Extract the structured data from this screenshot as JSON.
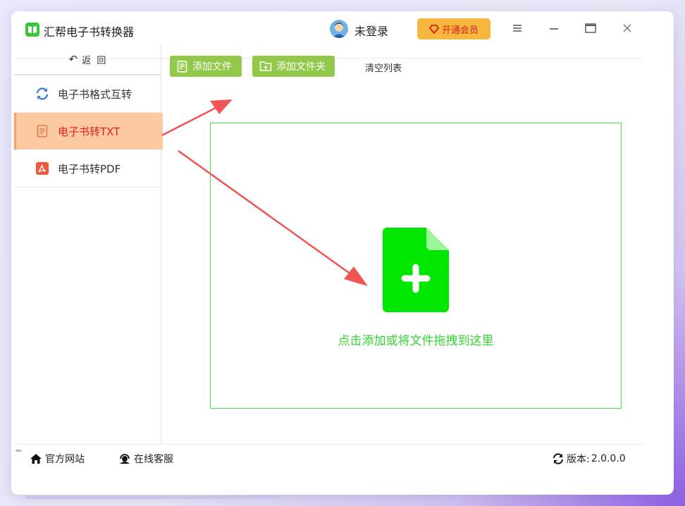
{
  "window": {
    "title": "汇帮电子书转换器",
    "login_label": "未登录",
    "vip_label": "开通会员"
  },
  "sidebar": {
    "back_label": "返  回",
    "items": [
      {
        "label": "电子书格式互转",
        "icon": "refresh-icon",
        "active": false
      },
      {
        "label": "电子书转TXT",
        "icon": "document-icon",
        "active": true
      },
      {
        "label": "电子书转PDF",
        "icon": "pdf-icon",
        "active": false
      }
    ]
  },
  "toolbar": {
    "add_file_label": "添加文件",
    "add_folder_label": "添加文件夹",
    "clear_label": "清空列表"
  },
  "dropzone": {
    "hint": "点击添加或将文件拖拽到这里"
  },
  "footer": {
    "website_label": "官方网站",
    "support_label": "在线客服",
    "version_label": "版本:",
    "version_value": "2.0.0.0"
  },
  "colors": {
    "accent_green": "#93c94a",
    "drop_green": "#00e600",
    "active_bg": "#fdc9a0",
    "active_text": "#e4201c",
    "vip_bg": "#f7b63e",
    "annotation_arrow": "#f05454"
  }
}
